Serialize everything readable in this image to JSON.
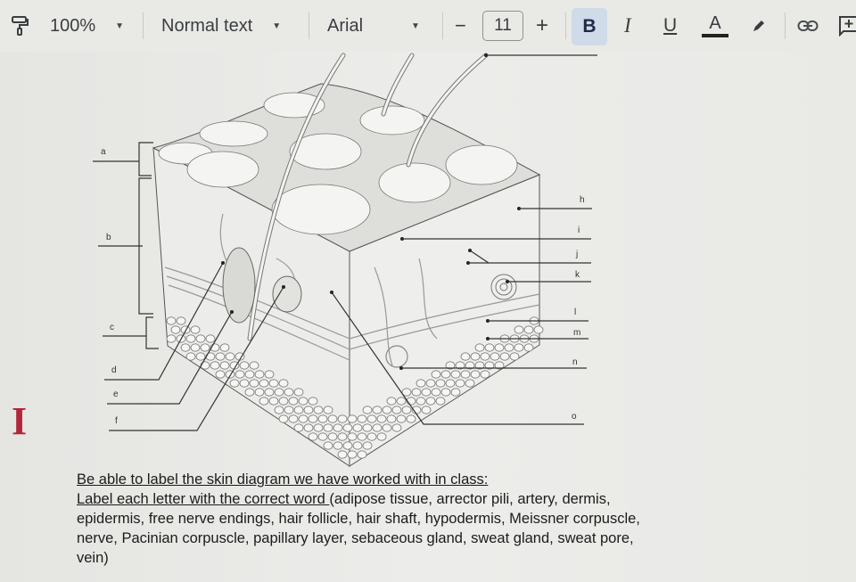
{
  "toolbar": {
    "paint_format_icon": "paint-roller-icon",
    "zoom": "100%",
    "style": "Normal text",
    "font": "Arial",
    "decrease_size": "−",
    "font_size": "11",
    "increase_size": "+",
    "bold": "B",
    "italic": "I",
    "underline": "U",
    "text_color": "A",
    "highlight_icon": "highlighter-pen-icon",
    "link_icon": "link-icon",
    "comment_icon": "add-comment-icon",
    "comment_glyph": "+"
  },
  "cursor": {
    "glyph": "I",
    "icon": "text-cursor-icon",
    "color": "#b2263c"
  },
  "diagram": {
    "title": "skin cross-section diagram",
    "left_labels": [
      "a",
      "b",
      "c",
      "d",
      "e",
      "f"
    ],
    "right_labels": [
      "h",
      "i",
      "j",
      "k",
      "l",
      "m",
      "n",
      "o"
    ]
  },
  "caption": {
    "line1": "Be able to label the skin diagram we have worked with in class:",
    "line2_underlined": "Label each letter with the correct word ",
    "line2_rest": "(adipose tissue, arrector pili, artery, dermis,",
    "line3": "epidermis, free nerve endings, hair follicle, hair shaft, hypodermis, Meissner corpuscle,",
    "line4": "nerve, Pacinian corpuscle, papillary layer, sebaceous gland, sweat gland, sweat pore,",
    "line5": "vein)"
  }
}
